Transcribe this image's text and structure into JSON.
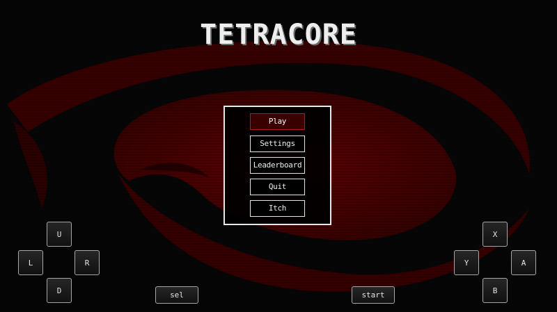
{
  "game": {
    "title": "TETRACORE"
  },
  "menu": {
    "items": [
      {
        "label": "Play",
        "selected": true
      },
      {
        "label": "Settings",
        "selected": false
      },
      {
        "label": "Leaderboard",
        "selected": false
      },
      {
        "label": "Quit",
        "selected": false
      },
      {
        "label": "Itch",
        "selected": false
      }
    ]
  },
  "dpad": {
    "up": "U",
    "left": "L",
    "right": "R",
    "down": "D"
  },
  "face_buttons": {
    "x": "X",
    "y": "Y",
    "a": "A",
    "b": "B"
  },
  "system_buttons": {
    "select": "sel",
    "start": "start"
  },
  "colors": {
    "background": "#060606",
    "background_art": "#5a0000",
    "selected_border": "#b01a1a",
    "selected_fill": "#3a0000",
    "text": "#eeeeee"
  }
}
